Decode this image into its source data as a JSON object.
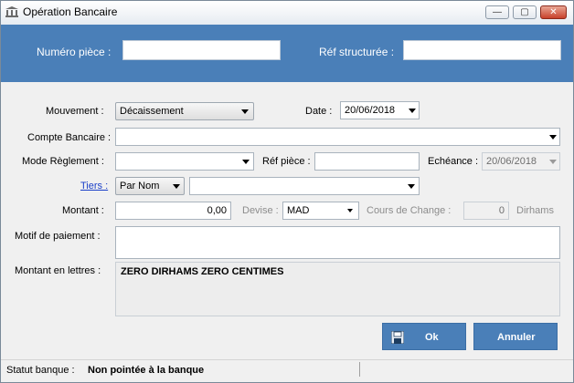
{
  "window": {
    "title": "Opération Bancaire",
    "minimize": "—",
    "maximize": "▢",
    "close": "✕"
  },
  "header": {
    "numero_label": "Numéro pièce :",
    "numero_value": "",
    "ref_label": "Réf structurée :",
    "ref_value": ""
  },
  "form": {
    "mouvement_label": "Mouvement :",
    "mouvement_value": "Décaissement",
    "date_label": "Date :",
    "date_value": "20/06/2018",
    "compte_label": "Compte Bancaire :",
    "compte_value": "",
    "mode_label": "Mode Règlement :",
    "mode_value": "",
    "refpiece_label": "Réf pièce :",
    "refpiece_value": "",
    "echeance_label": "Echéance :",
    "echeance_value": "20/06/2018",
    "tiers_label": "Tiers :",
    "tiers_mode_value": "Par Nom",
    "tiers_value": "",
    "montant_label": "Montant :",
    "montant_value": "0,00",
    "devise_label": "Devise :",
    "devise_value": "MAD",
    "cours_label": "Cours de Change :",
    "cours_value": "0",
    "dirhams_label": "Dirhams",
    "motif_label": "Motif de paiement :",
    "motif_value": "",
    "lettres_label": "Montant en lettres :",
    "lettres_value": "ZERO DIRHAMS ZERO CENTIMES"
  },
  "buttons": {
    "ok_label": "Ok",
    "annuler_label": "Annuler"
  },
  "status": {
    "label": "Statut banque :",
    "value": "Non pointée à la banque"
  },
  "colors": {
    "accent": "#4a7fb8",
    "link": "#1a3fc8",
    "disabled_text": "#8c8c8c"
  }
}
